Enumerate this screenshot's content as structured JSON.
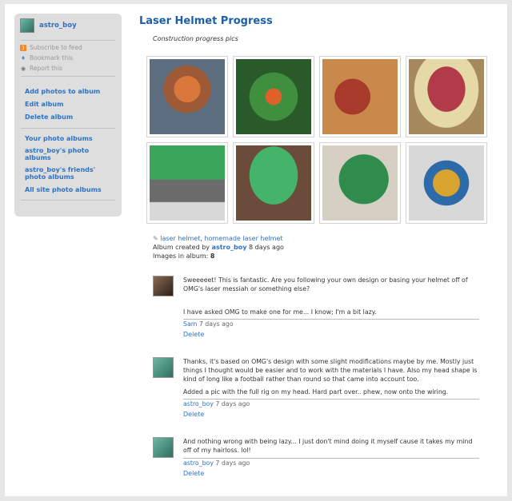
{
  "sidebar": {
    "username": "astro_boy",
    "subscribe": "Subscribe to feed",
    "bookmark": "Bookmark this",
    "report": "Report this",
    "add_photos": "Add photos to album",
    "edit_album": "Edit album",
    "delete_album": "Delete album",
    "your_albums": "Your photo albums",
    "user_albums": "astro_boy's photo albums",
    "friends_albums": "astro_boy's friends' photo albums",
    "all_albums": "All site photo albums"
  },
  "album": {
    "title": "Laser Helmet Progress",
    "description": "Construction progress pics",
    "tags": [
      "laser helmet",
      "homemade laser helmet"
    ],
    "created_prefix": "Album created by",
    "creator": "astro_boy",
    "created_ago": "8 days ago",
    "images_label": "Images in album:",
    "images_count": "8"
  },
  "comments": [
    {
      "p1": "Sweeeeet!  This is fantastic.  Are you following your own design or basing your helmet off of OMG's laser messiah or something else?",
      "p2": "I have asked OMG to make one for me... I know; I'm a bit lazy.",
      "author": "Sam",
      "ago": "7 days ago",
      "delete": "Delete"
    },
    {
      "p1": "Thanks, it's based on OMG's design with some slight modifications maybe by me. Mostly just things I thought would be easier and to work with the materials I have. Also my head shape is kind of long like a football rather than round so that came into account too.",
      "p2": "Added a pic with the full rig on my head. Hard part over.. phew, now onto the wiring.",
      "author": "astro_boy",
      "ago": "7 days ago",
      "delete": "Delete"
    },
    {
      "p1": "And nothing wrong with being lazy... I just don't mind doing it myself cause it takes my mind off of my hairloss. lol!",
      "author": "astro_boy",
      "ago": "7 days ago",
      "delete": "Delete"
    }
  ]
}
